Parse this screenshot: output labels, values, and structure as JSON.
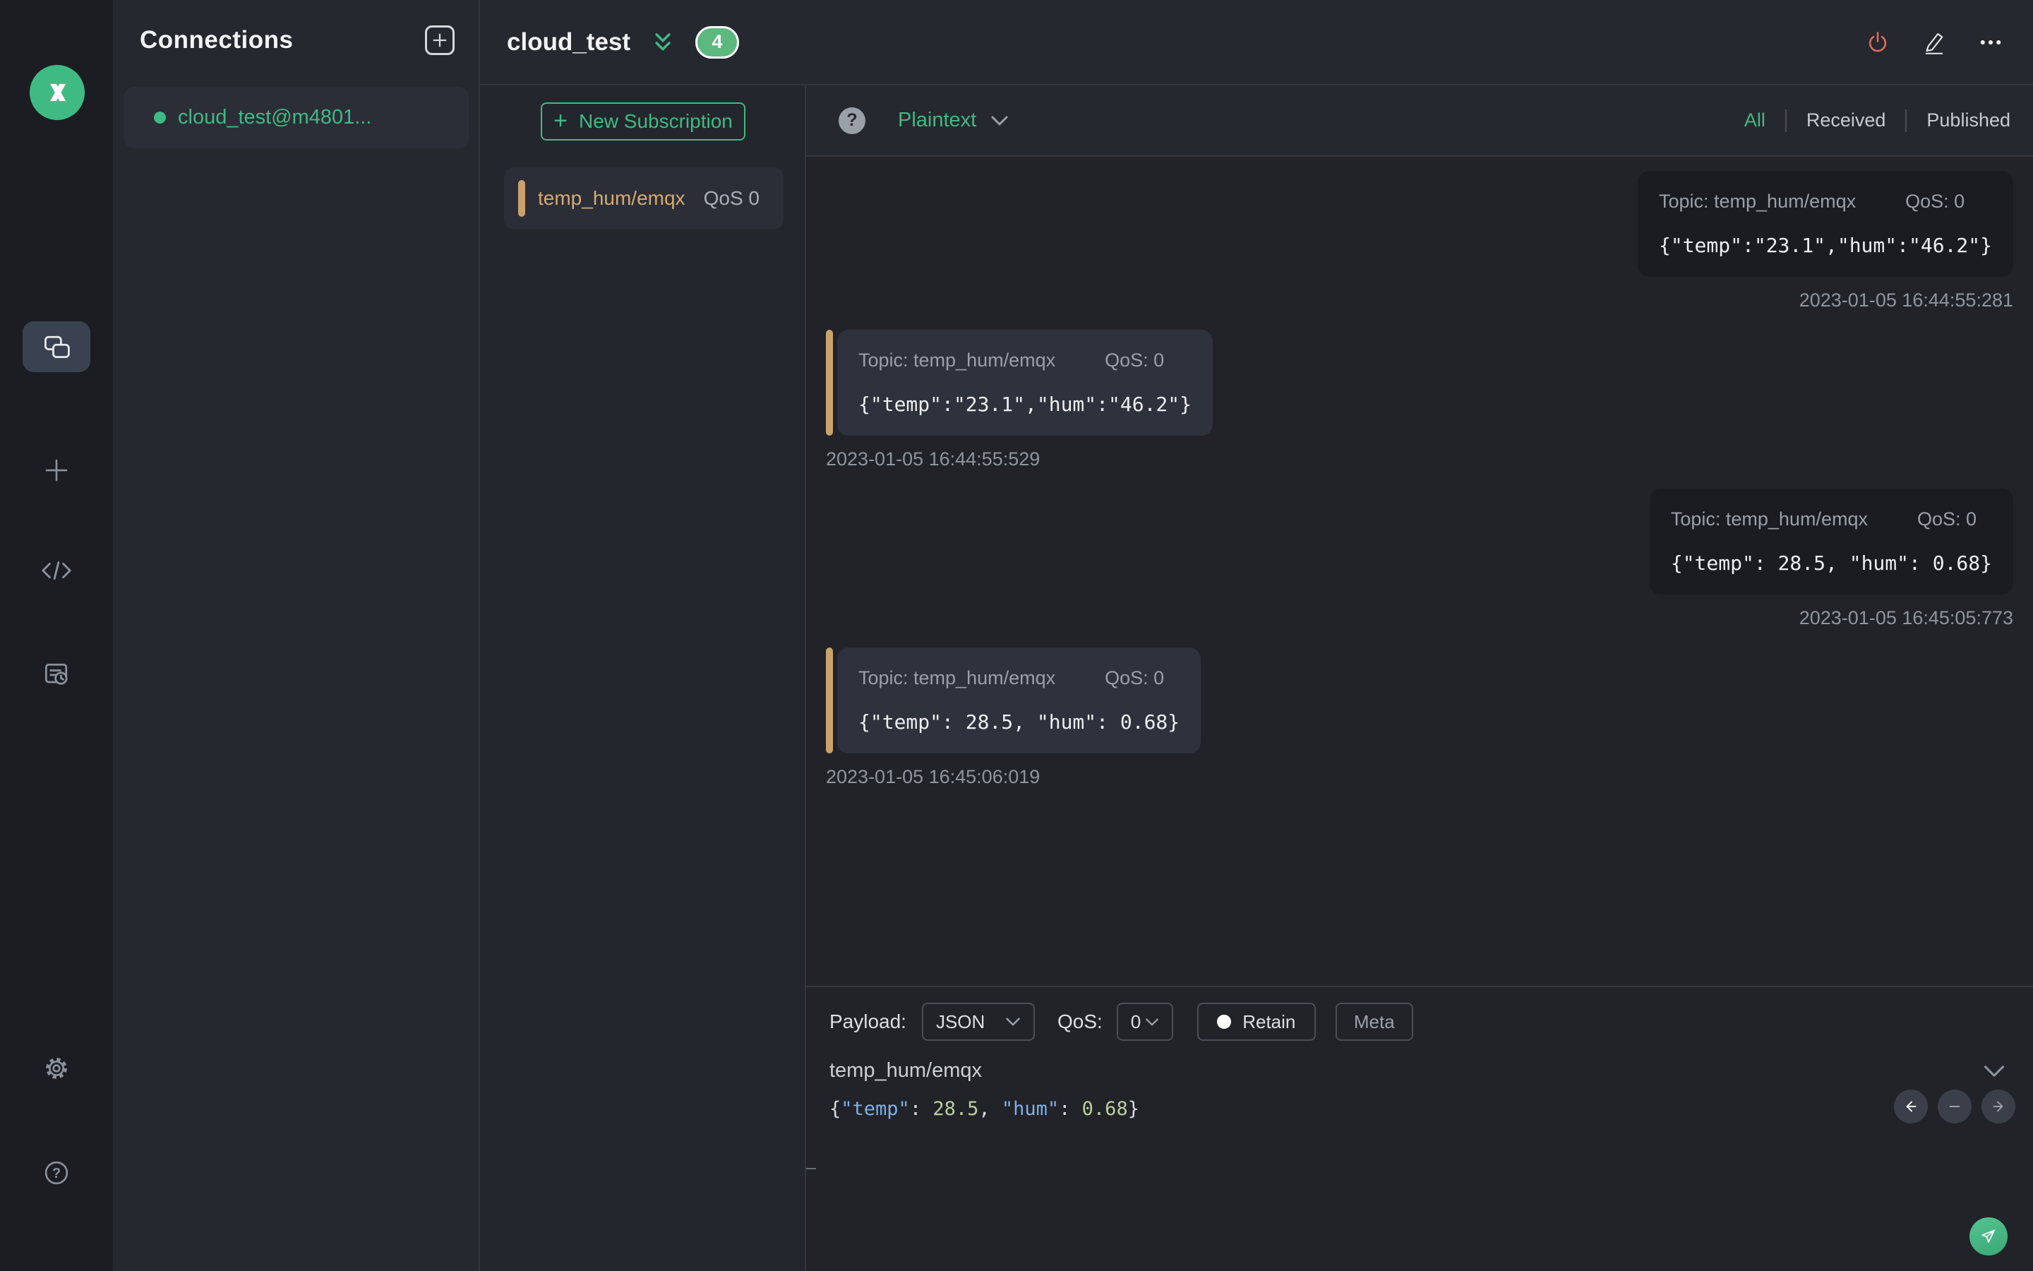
{
  "colors": {
    "accent_green": "#3fba83",
    "badge_green": "#5cb87f",
    "danger_red": "#e0695f",
    "topic_tan": "#d6ab71",
    "accent_bar_tan": "#c9a26b",
    "syntax_key_blue": "#7fb0e8",
    "syntax_number_green": "#b9cf9b",
    "panel_bg": "#26282f",
    "message_area_bg": "#212329"
  },
  "icons": {
    "logo": "mqttx-logo",
    "rail": [
      "connections-icon",
      "plus-icon",
      "code-icon",
      "log-icon",
      "settings-gear-icon",
      "help-icon"
    ],
    "topbar": [
      "power-icon",
      "edit-pencil-icon",
      "ellipsis-icon",
      "double-chevron-down-icon"
    ],
    "composer": [
      "chevron-down-icon",
      "arrow-left-icon",
      "minus-icon",
      "arrow-right-icon",
      "paper-plane-icon"
    ]
  },
  "connections": {
    "title": "Connections",
    "items": [
      {
        "name": "cloud_test@m4801...",
        "status": "connected"
      }
    ]
  },
  "header": {
    "title": "cloud_test",
    "badge_count": "4"
  },
  "subscriptions": {
    "new_button_label": "New Subscription",
    "new_button_plus": "+",
    "items": [
      {
        "topic": "temp_hum/emqx",
        "qos": "QoS 0"
      }
    ]
  },
  "filterbar": {
    "help_glyph": "?",
    "format_selected": "Plaintext",
    "tabs": {
      "all": "All",
      "received": "Received",
      "published": "Published"
    },
    "active_tab": "All"
  },
  "messages": [
    {
      "direction": "published",
      "topic_label": "Topic: temp_hum/emqx",
      "qos_label": "QoS: 0",
      "payload": "{\"temp\":\"23.1\",\"hum\":\"46.2\"}",
      "timestamp": "2023-01-05 16:44:55:281"
    },
    {
      "direction": "received",
      "topic_label": "Topic: temp_hum/emqx",
      "qos_label": "QoS: 0",
      "payload": "{\"temp\":\"23.1\",\"hum\":\"46.2\"}",
      "timestamp": "2023-01-05 16:44:55:529"
    },
    {
      "direction": "published",
      "topic_label": "Topic: temp_hum/emqx",
      "qos_label": "QoS: 0",
      "payload": "{\"temp\": 28.5, \"hum\": 0.68}",
      "timestamp": "2023-01-05 16:45:05:773"
    },
    {
      "direction": "received",
      "topic_label": "Topic: temp_hum/emqx",
      "qos_label": "QoS: 0",
      "payload": "{\"temp\": 28.5, \"hum\": 0.68}",
      "timestamp": "2023-01-05 16:45:06:019"
    }
  ],
  "publish": {
    "payload_label": "Payload:",
    "payload_format": "JSON",
    "qos_label": "QoS:",
    "qos_value": "0",
    "retain_label": "Retain",
    "meta_label": "Meta",
    "topic_value": "temp_hum/emqx",
    "editor_tokens": [
      {
        "text": "{",
        "type": "punct"
      },
      {
        "text": "\"temp\"",
        "type": "key"
      },
      {
        "text": ": ",
        "type": "punct"
      },
      {
        "text": "28.5",
        "type": "number"
      },
      {
        "text": ", ",
        "type": "punct"
      },
      {
        "text": "\"hum\"",
        "type": "key"
      },
      {
        "text": ": ",
        "type": "punct"
      },
      {
        "text": "0.68",
        "type": "number"
      },
      {
        "text": "}",
        "type": "punct"
      }
    ]
  }
}
